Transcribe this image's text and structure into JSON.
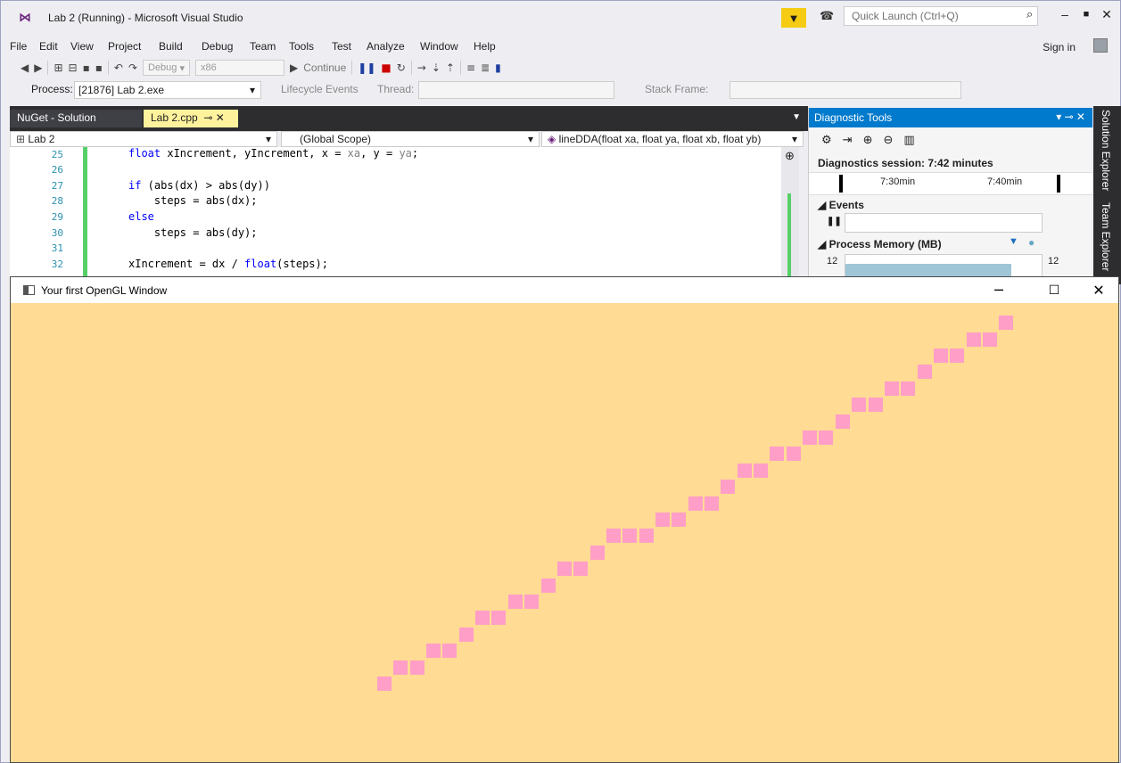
{
  "vs": {
    "title": "Lab 2 (Running) - Microsoft Visual Studio",
    "quick_launch_placeholder": "Quick Launch (Ctrl+Q)",
    "menu": [
      "File",
      "Edit",
      "View",
      "Project",
      "Build",
      "Debug",
      "Team",
      "Tools",
      "Test",
      "Analyze",
      "Window",
      "Help"
    ],
    "sign_in": "Sign in",
    "toolbar": {
      "config": "Debug",
      "platform": "x86",
      "continue": "Continue"
    },
    "debug_bar": {
      "process_label": "Process:",
      "process_value": "[21876] Lab 2.exe",
      "lifecycle": "Lifecycle Events",
      "thread": "Thread:",
      "stack_frame": "Stack Frame:"
    },
    "tabs": [
      {
        "label": "NuGet - Solution"
      },
      {
        "label": "Lab 2.cpp"
      }
    ],
    "nav": {
      "project": "Lab 2",
      "scope": "(Global Scope)",
      "member": "lineDDA(float xa, float ya, float xb, float yb)"
    },
    "code_lines": [
      {
        "n": "25",
        "pre": "float xIncrement, yIncrement, x = ",
        "p1": "xa",
        "mid": ", y = ",
        "p2": "ya",
        "post": ";"
      },
      {
        "n": "26"
      },
      {
        "n": "27",
        "text": "if (abs(dx) > abs(dy))"
      },
      {
        "n": "28",
        "text": "    steps = abs(dx);"
      },
      {
        "n": "29",
        "text": "else"
      },
      {
        "n": "30",
        "text": "    steps = abs(dy);"
      },
      {
        "n": "31"
      },
      {
        "n": "32",
        "pre": "xIncrement = dx / ",
        "kw": "float",
        "post": "(steps);"
      }
    ],
    "diagnostics": {
      "title": "Diagnostic Tools",
      "session": "Diagnostics session: 7:42 minutes",
      "time_labels": [
        "7:30min",
        "7:40min"
      ],
      "events": "Events",
      "process_memory": "Process Memory (MB)",
      "memory_left": "12",
      "memory_right": "12"
    },
    "side_tabs": [
      "Solution Explorer",
      "Team Explorer"
    ]
  },
  "gl_window": {
    "title": "Your first OpenGL Window",
    "background": "#ffdb94",
    "pixel_color": "#ff9ec7",
    "line": {
      "algorithm": "DDA",
      "pixels": [
        [
          0,
          0
        ],
        [
          1,
          1
        ],
        [
          2,
          1
        ],
        [
          3,
          2
        ],
        [
          4,
          2
        ],
        [
          5,
          3
        ],
        [
          6,
          4
        ],
        [
          7,
          4
        ],
        [
          8,
          5
        ],
        [
          9,
          5
        ],
        [
          10,
          6
        ],
        [
          11,
          7
        ],
        [
          12,
          7
        ],
        [
          13,
          8
        ],
        [
          14,
          9
        ],
        [
          15,
          9
        ],
        [
          16,
          9
        ],
        [
          17,
          10
        ],
        [
          18,
          10
        ],
        [
          19,
          11
        ],
        [
          20,
          11
        ],
        [
          21,
          12
        ],
        [
          22,
          13
        ],
        [
          23,
          13
        ],
        [
          24,
          14
        ],
        [
          25,
          14
        ],
        [
          26,
          15
        ],
        [
          27,
          15
        ],
        [
          28,
          16
        ],
        [
          29,
          17
        ],
        [
          30,
          17
        ],
        [
          31,
          18
        ],
        [
          32,
          18
        ],
        [
          33,
          19
        ],
        [
          34,
          20
        ],
        [
          35,
          20
        ],
        [
          36,
          21
        ],
        [
          37,
          21
        ],
        [
          38,
          22
        ]
      ]
    }
  }
}
